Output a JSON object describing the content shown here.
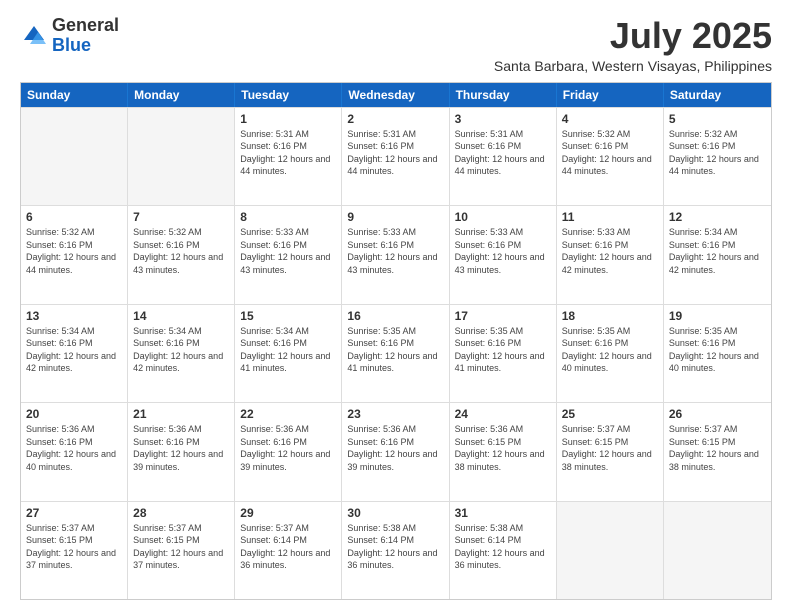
{
  "header": {
    "logo_general": "General",
    "logo_blue": "Blue",
    "month_title": "July 2025",
    "location": "Santa Barbara, Western Visayas, Philippines"
  },
  "days_of_week": [
    "Sunday",
    "Monday",
    "Tuesday",
    "Wednesday",
    "Thursday",
    "Friday",
    "Saturday"
  ],
  "weeks": [
    [
      {
        "day": "",
        "info": "",
        "empty": true
      },
      {
        "day": "",
        "info": "",
        "empty": true
      },
      {
        "day": "1",
        "info": "Sunrise: 5:31 AM\nSunset: 6:16 PM\nDaylight: 12 hours and 44 minutes."
      },
      {
        "day": "2",
        "info": "Sunrise: 5:31 AM\nSunset: 6:16 PM\nDaylight: 12 hours and 44 minutes."
      },
      {
        "day": "3",
        "info": "Sunrise: 5:31 AM\nSunset: 6:16 PM\nDaylight: 12 hours and 44 minutes."
      },
      {
        "day": "4",
        "info": "Sunrise: 5:32 AM\nSunset: 6:16 PM\nDaylight: 12 hours and 44 minutes."
      },
      {
        "day": "5",
        "info": "Sunrise: 5:32 AM\nSunset: 6:16 PM\nDaylight: 12 hours and 44 minutes."
      }
    ],
    [
      {
        "day": "6",
        "info": "Sunrise: 5:32 AM\nSunset: 6:16 PM\nDaylight: 12 hours and 44 minutes."
      },
      {
        "day": "7",
        "info": "Sunrise: 5:32 AM\nSunset: 6:16 PM\nDaylight: 12 hours and 43 minutes."
      },
      {
        "day": "8",
        "info": "Sunrise: 5:33 AM\nSunset: 6:16 PM\nDaylight: 12 hours and 43 minutes."
      },
      {
        "day": "9",
        "info": "Sunrise: 5:33 AM\nSunset: 6:16 PM\nDaylight: 12 hours and 43 minutes."
      },
      {
        "day": "10",
        "info": "Sunrise: 5:33 AM\nSunset: 6:16 PM\nDaylight: 12 hours and 43 minutes."
      },
      {
        "day": "11",
        "info": "Sunrise: 5:33 AM\nSunset: 6:16 PM\nDaylight: 12 hours and 42 minutes."
      },
      {
        "day": "12",
        "info": "Sunrise: 5:34 AM\nSunset: 6:16 PM\nDaylight: 12 hours and 42 minutes."
      }
    ],
    [
      {
        "day": "13",
        "info": "Sunrise: 5:34 AM\nSunset: 6:16 PM\nDaylight: 12 hours and 42 minutes."
      },
      {
        "day": "14",
        "info": "Sunrise: 5:34 AM\nSunset: 6:16 PM\nDaylight: 12 hours and 42 minutes."
      },
      {
        "day": "15",
        "info": "Sunrise: 5:34 AM\nSunset: 6:16 PM\nDaylight: 12 hours and 41 minutes."
      },
      {
        "day": "16",
        "info": "Sunrise: 5:35 AM\nSunset: 6:16 PM\nDaylight: 12 hours and 41 minutes."
      },
      {
        "day": "17",
        "info": "Sunrise: 5:35 AM\nSunset: 6:16 PM\nDaylight: 12 hours and 41 minutes."
      },
      {
        "day": "18",
        "info": "Sunrise: 5:35 AM\nSunset: 6:16 PM\nDaylight: 12 hours and 40 minutes."
      },
      {
        "day": "19",
        "info": "Sunrise: 5:35 AM\nSunset: 6:16 PM\nDaylight: 12 hours and 40 minutes."
      }
    ],
    [
      {
        "day": "20",
        "info": "Sunrise: 5:36 AM\nSunset: 6:16 PM\nDaylight: 12 hours and 40 minutes."
      },
      {
        "day": "21",
        "info": "Sunrise: 5:36 AM\nSunset: 6:16 PM\nDaylight: 12 hours and 39 minutes."
      },
      {
        "day": "22",
        "info": "Sunrise: 5:36 AM\nSunset: 6:16 PM\nDaylight: 12 hours and 39 minutes."
      },
      {
        "day": "23",
        "info": "Sunrise: 5:36 AM\nSunset: 6:16 PM\nDaylight: 12 hours and 39 minutes."
      },
      {
        "day": "24",
        "info": "Sunrise: 5:36 AM\nSunset: 6:15 PM\nDaylight: 12 hours and 38 minutes."
      },
      {
        "day": "25",
        "info": "Sunrise: 5:37 AM\nSunset: 6:15 PM\nDaylight: 12 hours and 38 minutes."
      },
      {
        "day": "26",
        "info": "Sunrise: 5:37 AM\nSunset: 6:15 PM\nDaylight: 12 hours and 38 minutes."
      }
    ],
    [
      {
        "day": "27",
        "info": "Sunrise: 5:37 AM\nSunset: 6:15 PM\nDaylight: 12 hours and 37 minutes."
      },
      {
        "day": "28",
        "info": "Sunrise: 5:37 AM\nSunset: 6:15 PM\nDaylight: 12 hours and 37 minutes."
      },
      {
        "day": "29",
        "info": "Sunrise: 5:37 AM\nSunset: 6:14 PM\nDaylight: 12 hours and 36 minutes."
      },
      {
        "day": "30",
        "info": "Sunrise: 5:38 AM\nSunset: 6:14 PM\nDaylight: 12 hours and 36 minutes."
      },
      {
        "day": "31",
        "info": "Sunrise: 5:38 AM\nSunset: 6:14 PM\nDaylight: 12 hours and 36 minutes."
      },
      {
        "day": "",
        "info": "",
        "empty": true
      },
      {
        "day": "",
        "info": "",
        "empty": true
      }
    ]
  ]
}
